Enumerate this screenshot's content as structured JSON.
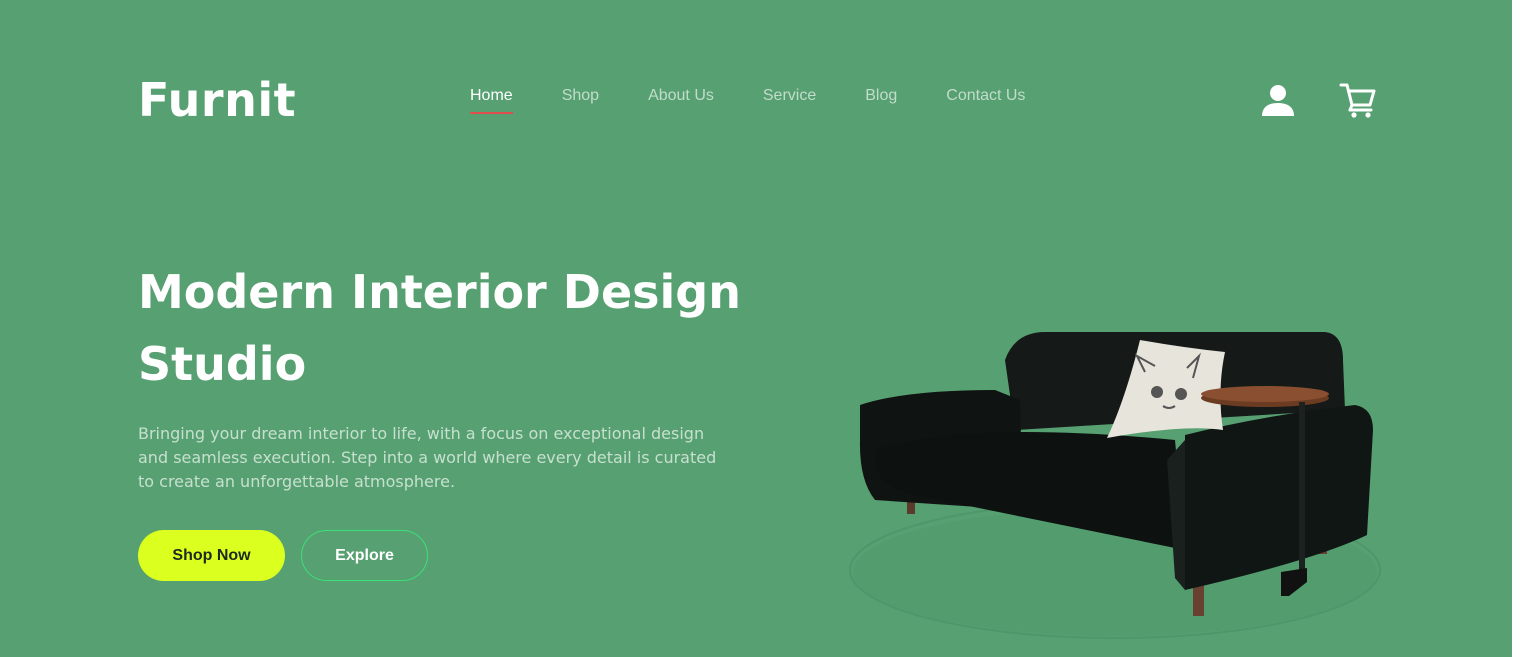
{
  "brand": {
    "logo": "Furnit"
  },
  "nav": {
    "items": [
      {
        "label": "Home",
        "active": true
      },
      {
        "label": "Shop",
        "active": false
      },
      {
        "label": "About Us",
        "active": false
      },
      {
        "label": "Service",
        "active": false
      },
      {
        "label": "Blog",
        "active": false
      },
      {
        "label": "Contact Us",
        "active": false
      }
    ]
  },
  "header_icons": [
    "user-icon",
    "cart-icon"
  ],
  "hero": {
    "title": "Modern Interior Design Studio",
    "description": "Bringing your dream interior to life, with a focus on exceptional design and seamless execution. Step into a world where every detail is curated to create an unforgettable atmosphere.",
    "primary_button": "Shop Now",
    "secondary_button": "Explore"
  },
  "colors": {
    "background": "#57a072",
    "accent_button": "#dbff1f",
    "outline_button": "#3ce07a",
    "active_underline": "#e04e4e"
  }
}
